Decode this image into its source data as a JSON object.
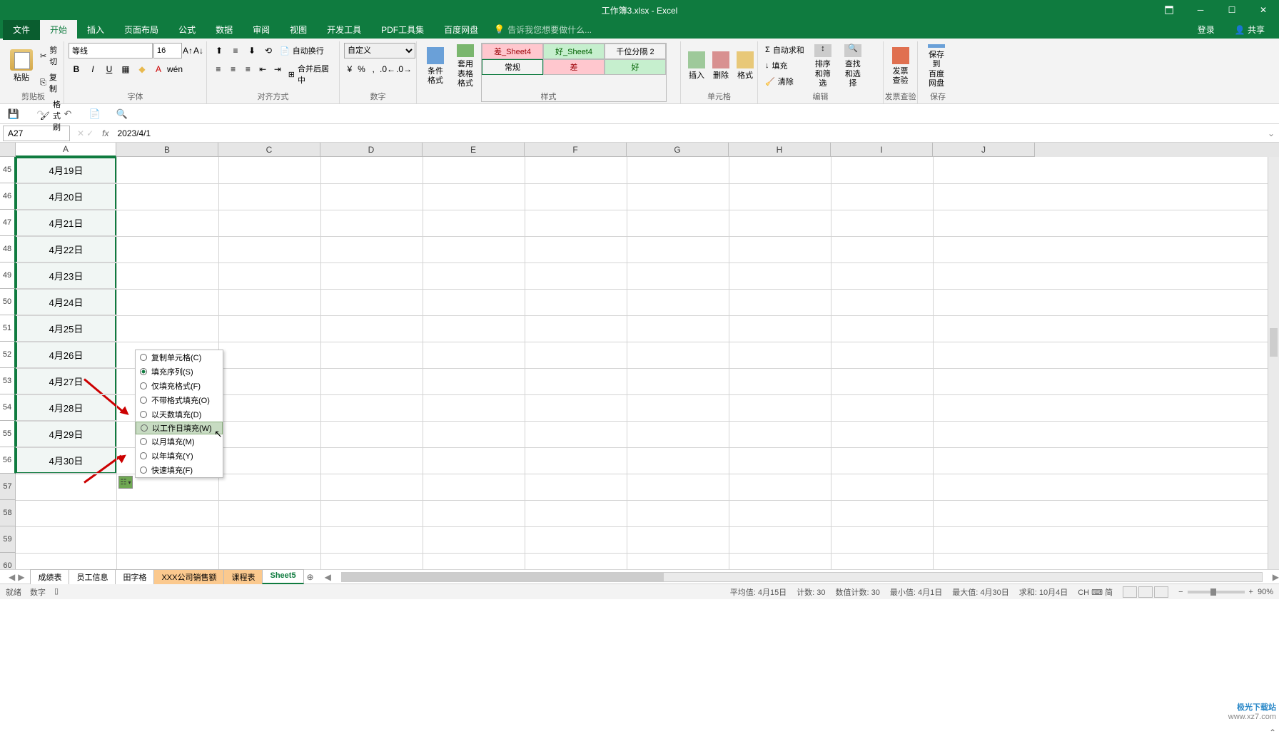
{
  "titlebar": {
    "title": "工作簿3.xlsx - Excel"
  },
  "ribbon_tabs": {
    "file": "文件",
    "home": "开始",
    "insert": "插入",
    "page_layout": "页面布局",
    "formulas": "公式",
    "data": "数据",
    "review": "审阅",
    "view": "视图",
    "developer": "开发工具",
    "pdf": "PDF工具集",
    "baidu": "百度网盘",
    "tell_me": "告诉我您想要做什么...",
    "login": "登录",
    "share": "共享"
  },
  "ribbon": {
    "clipboard": {
      "label": "剪贴板",
      "paste": "粘贴",
      "cut": "剪切",
      "copy": "复制",
      "format_painter": "格式刷"
    },
    "font": {
      "label": "字体",
      "name": "等线",
      "size": "16"
    },
    "alignment": {
      "label": "对齐方式",
      "wrap": "自动换行",
      "merge": "合并后居中"
    },
    "number": {
      "label": "数字",
      "format": "自定义"
    },
    "styles": {
      "label": "样式",
      "cond_format": "条件格式",
      "table_format": "套用\n表格格式",
      "gallery": {
        "bad_sheet": "差_Sheet4",
        "good_sheet": "好_Sheet4",
        "comma2": "千位分隔 2",
        "normal": "常规",
        "bad": "差",
        "good": "好"
      }
    },
    "cells": {
      "label": "单元格",
      "insert": "插入",
      "delete": "删除",
      "format": "格式"
    },
    "editing": {
      "label": "编辑",
      "autosum": "自动求和",
      "fill": "填充",
      "clear": "清除",
      "sort": "排序和筛选",
      "find": "查找和选择"
    },
    "invoice": {
      "label": "发票查验",
      "check": "发票\n查验"
    },
    "save": {
      "label": "保存",
      "baidu": "保存到\n百度网盘"
    }
  },
  "formula_bar": {
    "name_box": "A27",
    "formula": "2023/4/1"
  },
  "columns": [
    "A",
    "B",
    "C",
    "D",
    "E",
    "F",
    "G",
    "H",
    "I",
    "J"
  ],
  "rows": [
    {
      "n": 45,
      "val": "4月19日"
    },
    {
      "n": 46,
      "val": "4月20日"
    },
    {
      "n": 47,
      "val": "4月21日"
    },
    {
      "n": 48,
      "val": "4月22日"
    },
    {
      "n": 49,
      "val": "4月23日"
    },
    {
      "n": 50,
      "val": "4月24日"
    },
    {
      "n": 51,
      "val": "4月25日"
    },
    {
      "n": 52,
      "val": "4月26日"
    },
    {
      "n": 53,
      "val": "4月27日"
    },
    {
      "n": 54,
      "val": "4月28日"
    },
    {
      "n": 55,
      "val": "4月29日"
    },
    {
      "n": 56,
      "val": "4月30日"
    },
    {
      "n": 57,
      "val": ""
    },
    {
      "n": 58,
      "val": ""
    },
    {
      "n": 59,
      "val": ""
    },
    {
      "n": 60,
      "val": ""
    }
  ],
  "autofill_menu": {
    "items": [
      {
        "label": "复制单元格(C)",
        "sel": false,
        "hot": "C"
      },
      {
        "label": "填充序列(S)",
        "sel": true,
        "hot": "S"
      },
      {
        "label": "仅填充格式(F)",
        "sel": false,
        "hot": "F"
      },
      {
        "label": "不带格式填充(O)",
        "sel": false,
        "hot": "O"
      },
      {
        "label": "以天数填充(D)",
        "sel": false,
        "hot": "D"
      },
      {
        "label": "以工作日填充(W)",
        "sel": false,
        "hot": "W",
        "highlighted": true
      },
      {
        "label": "以月填充(M)",
        "sel": false,
        "hot": "M"
      },
      {
        "label": "以年填充(Y)",
        "sel": false,
        "hot": "Y"
      },
      {
        "label": "快速填充(F)",
        "sel": false,
        "hot": "F"
      }
    ]
  },
  "sheet_tabs": {
    "tabs": [
      {
        "name": "成绩表"
      },
      {
        "name": "员工信息"
      },
      {
        "name": "田字格"
      },
      {
        "name": "XXX公司销售额",
        "style": "orange"
      },
      {
        "name": "课程表",
        "style": "orange"
      },
      {
        "name": "Sheet5",
        "active": true
      }
    ]
  },
  "status_bar": {
    "ready": "就绪",
    "mode": "数字",
    "avg": "平均值: 4月15日",
    "count": "计数: 30",
    "numcount": "数值计数: 30",
    "min": "最小值: 4月1日",
    "max": "最大值: 4月30日",
    "sum": "求和: 10月4日",
    "ime": "CH ⌨ 简",
    "zoom": "90%"
  },
  "watermark": {
    "l1": "极光下载站",
    "l2": "www.xz7.com"
  }
}
